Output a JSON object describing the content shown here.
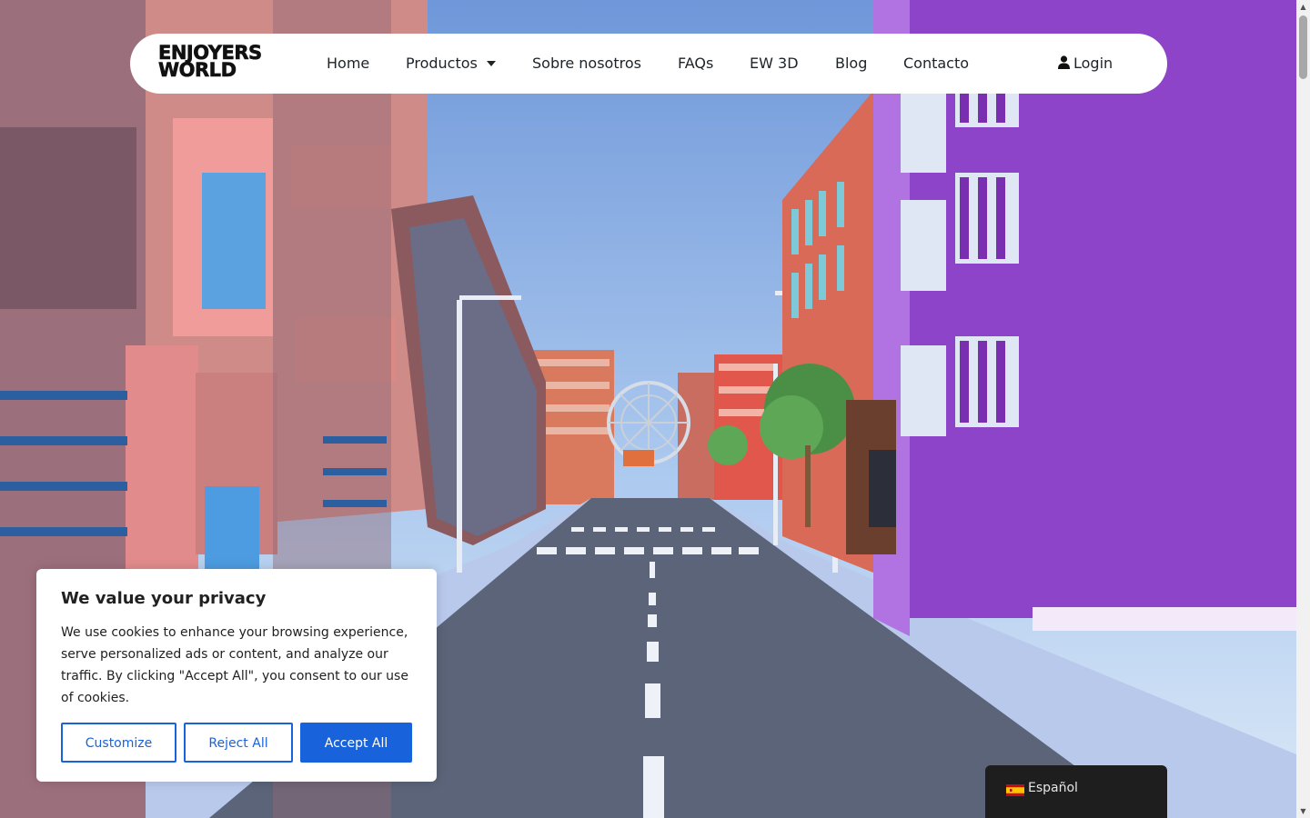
{
  "brand": {
    "line1": "ENJOYERS",
    "line2": "WORLD"
  },
  "nav": {
    "items": [
      {
        "label": "Home"
      },
      {
        "label": "Productos"
      },
      {
        "label": "Sobre nosotros"
      },
      {
        "label": "FAQs"
      },
      {
        "label": "EW 3D"
      },
      {
        "label": "Blog"
      },
      {
        "label": "Contacto"
      }
    ],
    "login": "Login"
  },
  "cookie": {
    "title": "We value your privacy",
    "text": "We use cookies to enhance your browsing experience, serve personalized ads or content, and analyze our traffic. By clicking \"Accept All\", you consent to our use of cookies.",
    "customize": "Customize",
    "reject": "Reject All",
    "accept": "Accept All"
  },
  "language": {
    "label": "Español",
    "flag": "spain-flag-icon"
  },
  "colors": {
    "accent": "#1863dc",
    "nav_bg": "#ffffff",
    "lang_bg": "#1e1e1e",
    "sky": "#8fb4e8",
    "purple_building": "#8e44c8"
  }
}
